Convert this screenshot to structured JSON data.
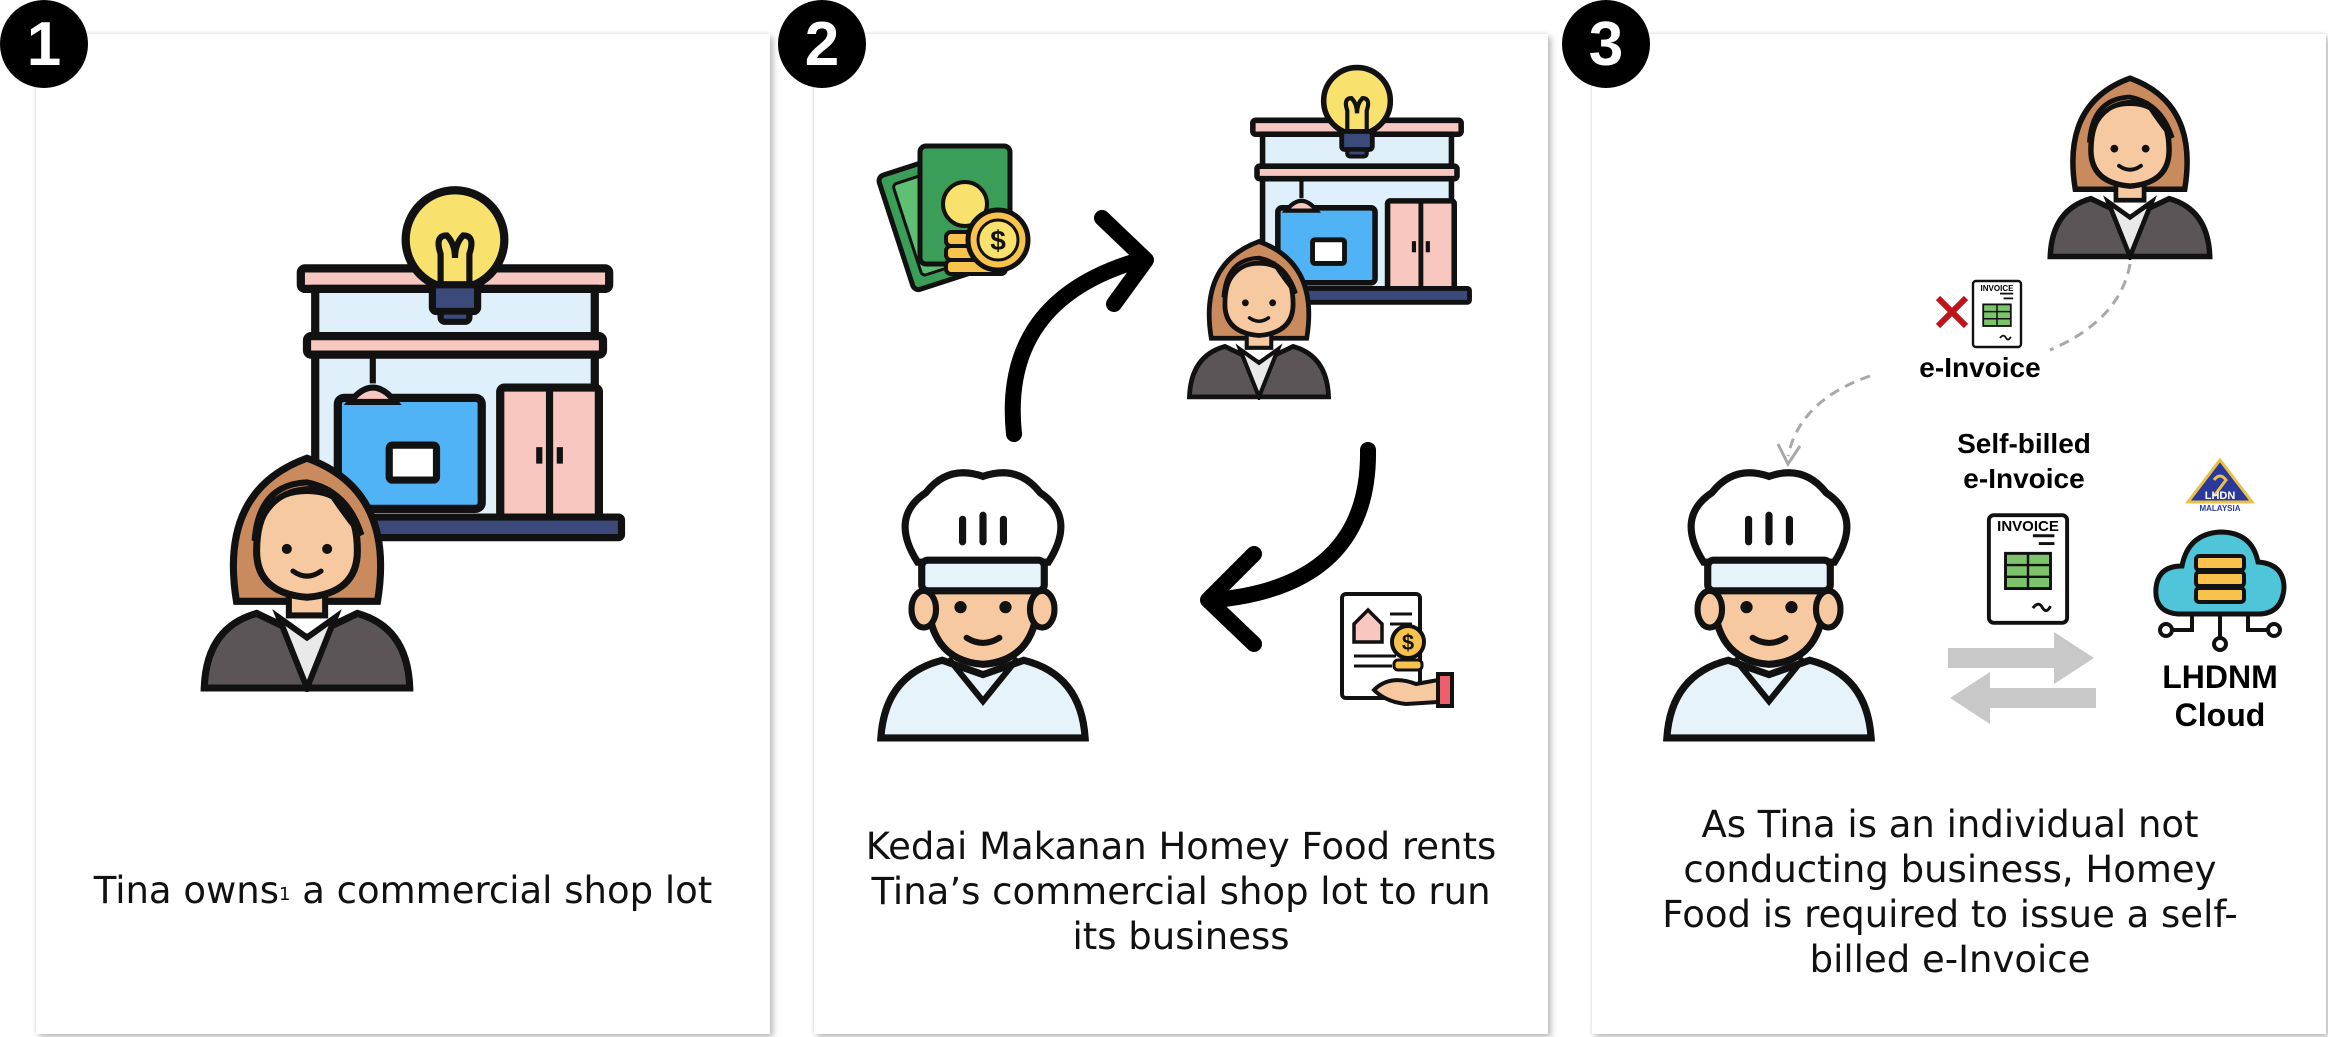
{
  "panels": [
    {
      "number": "1",
      "caption_before_sup": "Tina owns",
      "caption_sup": "1",
      "caption_after_sup": " a commercial shop lot"
    },
    {
      "number": "2",
      "caption": "Kedai Makanan Homey Food rents Tina’s commercial shop lot to run its business"
    },
    {
      "number": "3",
      "einvoice_label": "e-Invoice",
      "selfbilled_label": "Self-billed e-Invoice",
      "cloud_label": "LHDNM Cloud",
      "logo_text": "LHDN",
      "logo_subtext": "MALAYSIA",
      "invoice_doc_text": "INVOICE",
      "caption": "As Tina is an individual not conducting business, Homey Food is required to issue a self-billed e-Invoice"
    }
  ],
  "icons": {
    "shop": "shop-icon",
    "woman": "businesswoman-icon",
    "chef": "chef-icon",
    "money": "money-icon",
    "rent": "rent-invoice-icon",
    "cloud": "cloud-server-icon"
  },
  "colors": {
    "badge": "#000000",
    "arrow": "#000000",
    "cross": "#c0141c",
    "gray_arrow": "#c8c8c8",
    "shop_blue": "#4fb3f6",
    "door_pink": "#f7c7c0",
    "bulb_yellow": "#f8e16c",
    "hair_brown": "#c98a5e",
    "suit_gray": "#5b5557"
  }
}
